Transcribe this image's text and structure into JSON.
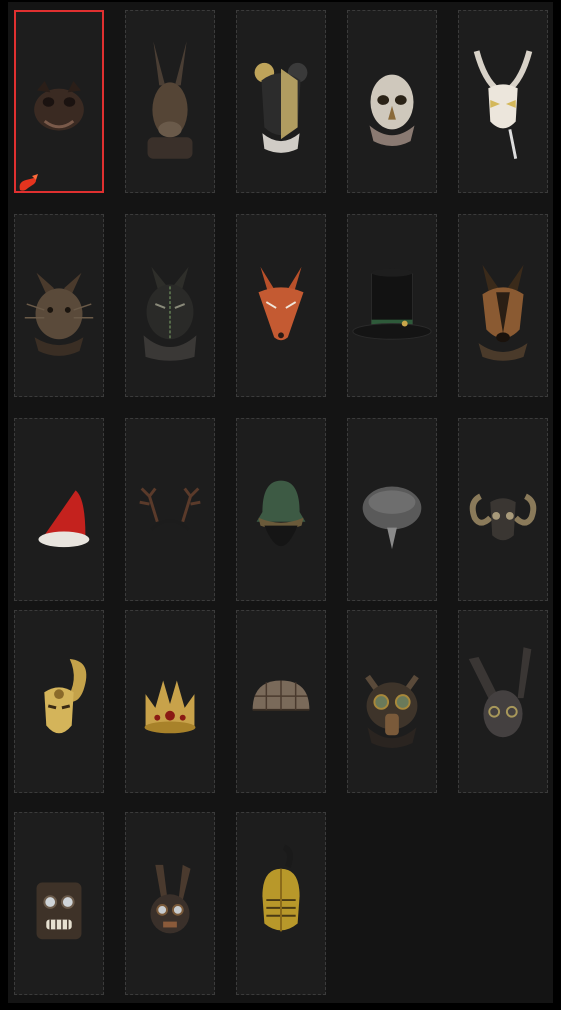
{
  "grid": {
    "selected_index": 0,
    "items": [
      {
        "icon": "bulldog-mask-icon"
      },
      {
        "icon": "donkey-mask-icon"
      },
      {
        "icon": "mouse-harlequin-mask-icon"
      },
      {
        "icon": "owl-mask-icon"
      },
      {
        "icon": "venetian-moon-mask-icon"
      },
      {
        "icon": "scarecrow-cat-mask-icon"
      },
      {
        "icon": "stitched-cat-mask-icon"
      },
      {
        "icon": "fox-mask-icon"
      },
      {
        "icon": "top-hat-icon"
      },
      {
        "icon": "shepherd-dog-mask-icon"
      },
      {
        "icon": "santa-hat-icon"
      },
      {
        "icon": "antler-headband-icon"
      },
      {
        "icon": "green-hood-icon"
      },
      {
        "icon": "fur-ushanka-icon"
      },
      {
        "icon": "ram-skull-mask-icon"
      },
      {
        "icon": "golden-wave-mask-icon"
      },
      {
        "icon": "golden-crown-icon"
      },
      {
        "icon": "plaid-cap-icon"
      },
      {
        "icon": "pig-gas-mask-icon"
      },
      {
        "icon": "rabbit-mask-icon"
      },
      {
        "icon": "bucket-robot-mask-icon"
      },
      {
        "icon": "steampunk-rabbit-mask-icon"
      },
      {
        "icon": "knight-helmet-icon"
      }
    ]
  },
  "colors": {
    "selection": "#e03030",
    "slot_bg": "#1d1d1d",
    "slot_border": "#3b3b3b"
  }
}
